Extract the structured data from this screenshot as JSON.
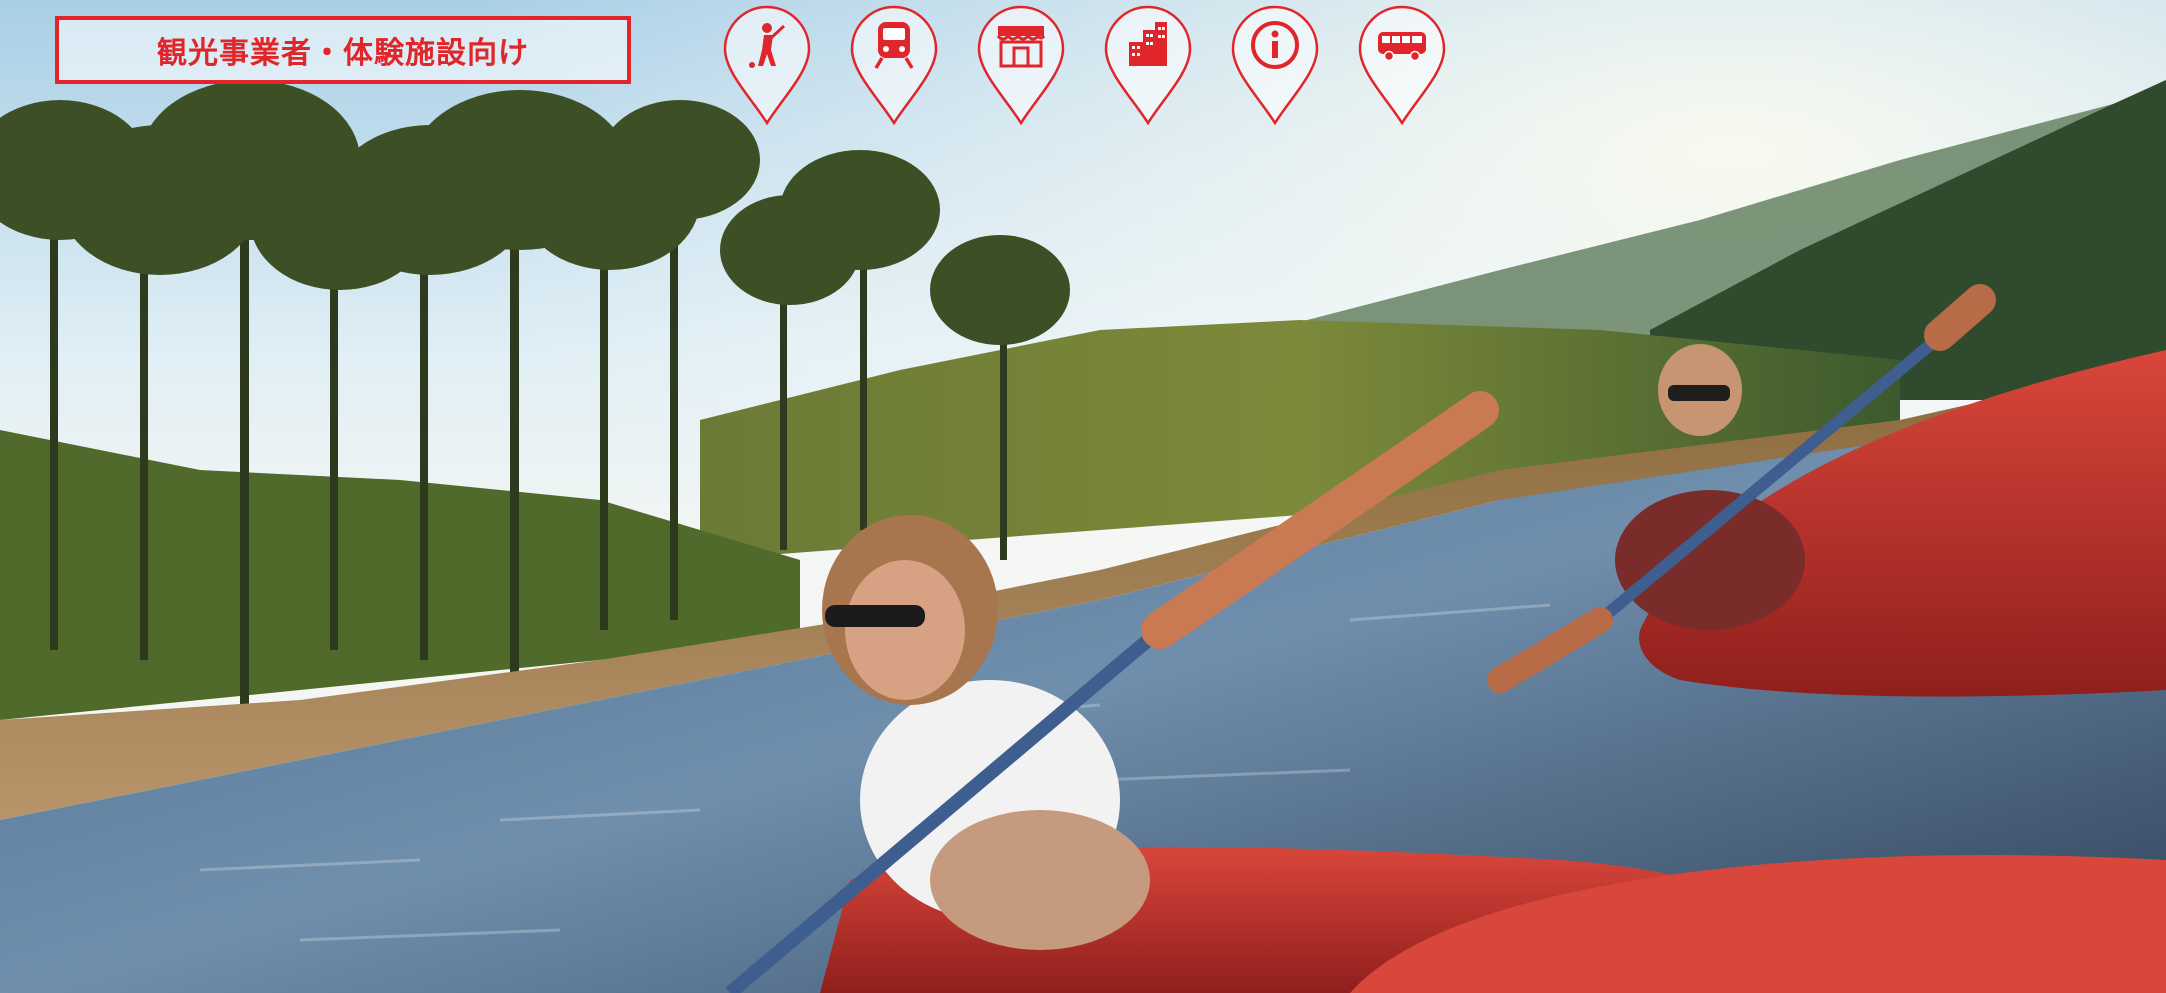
{
  "header": {
    "audience_button_label": "観光事業者・体験施設向け"
  },
  "category_pins": [
    {
      "icon": "golf-icon"
    },
    {
      "icon": "train-icon"
    },
    {
      "icon": "shop-icon"
    },
    {
      "icon": "building-icon"
    },
    {
      "icon": "info-icon"
    },
    {
      "icon": "bus-icon"
    }
  ],
  "colors": {
    "accent": "#e0262b",
    "pin_fill": "#ffffff"
  }
}
